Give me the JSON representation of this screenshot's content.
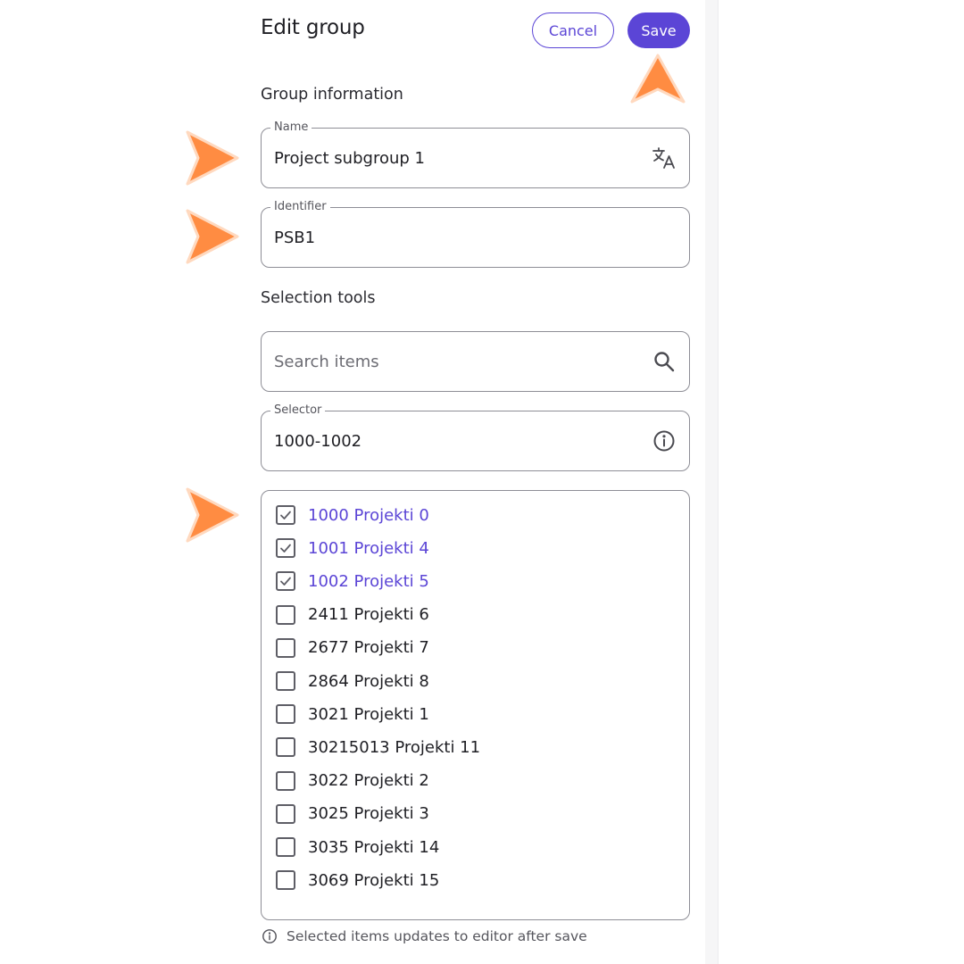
{
  "dialog": {
    "title": "Edit group",
    "cancel_label": "Cancel",
    "save_label": "Save"
  },
  "group_information": {
    "heading": "Group information",
    "name": {
      "label": "Name",
      "value": "Project subgroup 1",
      "icon": "translate-icon"
    },
    "identifier": {
      "label": "Identifier",
      "value": "PSB1"
    }
  },
  "selection_tools": {
    "heading": "Selection tools",
    "search": {
      "placeholder": "Search items",
      "icon": "search-icon"
    },
    "selector": {
      "label": "Selector",
      "value": "1000-1002",
      "icon": "info-icon"
    }
  },
  "items": [
    {
      "label": "1000 Projekti 0",
      "checked": true
    },
    {
      "label": "1001 Projekti 4",
      "checked": true
    },
    {
      "label": "1002 Projekti 5",
      "checked": true
    },
    {
      "label": "2411 Projekti 6",
      "checked": false
    },
    {
      "label": "2677 Projekti 7",
      "checked": false
    },
    {
      "label": "2864 Projekti 8",
      "checked": false
    },
    {
      "label": "3021 Projekti 1",
      "checked": false
    },
    {
      "label": "30215013 Projekti 11",
      "checked": false
    },
    {
      "label": "3022 Projekti 2",
      "checked": false
    },
    {
      "label": "3025 Projekti 3",
      "checked": false
    },
    {
      "label": "3035 Projekti 14",
      "checked": false
    },
    {
      "label": "3069 Projekti 15",
      "checked": false
    }
  ],
  "helper_text": "Selected items updates to editor after save",
  "colors": {
    "accent": "#5b45d6",
    "annotation_arrow": "#ff8c42",
    "border": "#8e8e96"
  }
}
